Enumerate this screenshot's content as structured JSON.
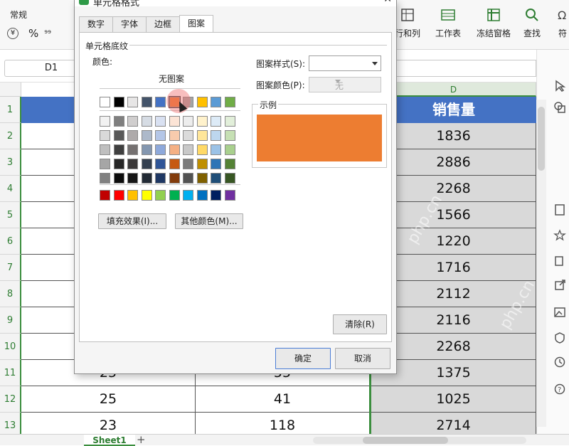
{
  "colors": {
    "header_blue": "#4472c4",
    "selected_green": "#3b8e3e",
    "pattern_orange": "#ed7d31",
    "dim_cell": "#d9d9d9"
  },
  "ribbon": {
    "font_name": "常规",
    "buttons": [
      {
        "label": "行和列",
        "icon": "rows-columns-icon"
      },
      {
        "label": "工作表",
        "icon": "worksheet-icon"
      },
      {
        "label": "冻结窗格",
        "icon": "freeze-panes-icon"
      },
      {
        "label": "查找",
        "icon": "search-icon"
      },
      {
        "label": "符",
        "icon": "symbol-icon"
      }
    ]
  },
  "name_box": "D1",
  "grid": {
    "columns": [
      "D"
    ],
    "header_text": "销售量",
    "rows": [
      {
        "num": "1"
      },
      {
        "num": "2",
        "d": "1836"
      },
      {
        "num": "3",
        "d": "2886"
      },
      {
        "num": "4",
        "d": "2268"
      },
      {
        "num": "5",
        "d": "1566"
      },
      {
        "num": "6",
        "d": "1220"
      },
      {
        "num": "7",
        "d": "1716"
      },
      {
        "num": "8",
        "d": "2112"
      },
      {
        "num": "9",
        "d": "2116"
      },
      {
        "num": "10",
        "d": "2268"
      },
      {
        "num": "11",
        "b": "25",
        "c": "55",
        "d": "1375"
      },
      {
        "num": "12",
        "b": "25",
        "c": "41",
        "d": "1025"
      },
      {
        "num": "13",
        "b": "23",
        "c": "118",
        "d": "2714"
      }
    ]
  },
  "sheet_tab": "Sheet1",
  "dialog": {
    "title": "单元格格式",
    "tabs": [
      "数字",
      "字体",
      "边框",
      "图案"
    ],
    "active_tab": "图案",
    "section_title": "单元格底纹",
    "color_label": "颜色:",
    "no_pattern_label": "无图案",
    "fill_effects_button": "填充效果(I)...",
    "more_colors_button": "其他颜色(M)...",
    "pattern_style_label": "图案样式(S):",
    "pattern_color_label": "图案颜色(P):",
    "pattern_color_value": "无",
    "example_label": "示例",
    "clear_button": "清除(R)",
    "ok_button": "确定",
    "cancel_button": "取消"
  },
  "watermark": "php.cn"
}
